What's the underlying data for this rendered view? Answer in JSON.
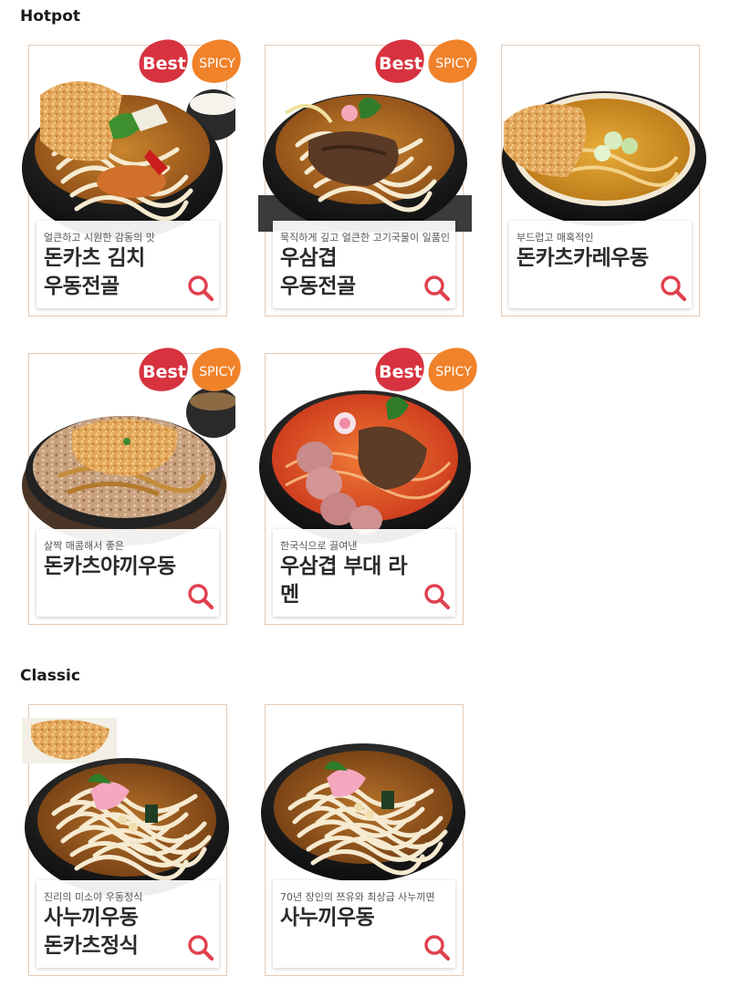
{
  "sections": {
    "hotpot": {
      "title": "Hotpot"
    },
    "classic": {
      "title": "Classic"
    }
  },
  "badges": {
    "best": "Best",
    "spicy": "SPICY"
  },
  "items": {
    "c1": {
      "tagline": "얼큰하고 시원한 감동의 맛",
      "name": "돈카츠 김치\n우동전골"
    },
    "c2": {
      "tagline": "묵직하게 깊고 얼큰한 고기국물이 일품인",
      "name": "우삼겹\n우동전골"
    },
    "c3": {
      "tagline": "부드럽고 매혹적인",
      "name": "돈카츠카레우동"
    },
    "c4": {
      "tagline": "살짝 매콤해서 좋은",
      "name": "돈카츠야끼우동"
    },
    "c5": {
      "tagline": "한국식으로 끓여낸",
      "name": "우삼겹 부대 라멘"
    },
    "c6": {
      "tagline": "진리의 미소야 우동정식",
      "name": "사누끼우동\n돈카츠정식"
    },
    "c7": {
      "tagline": "70년 장인의 쯔유와 최상급 사누끼면",
      "name": "사누끼우동"
    }
  },
  "colors": {
    "accent": "#e0404e",
    "best_badge": "#d7323f",
    "spicy_badge": "#f0822a",
    "card_border": "#e2c9b6"
  },
  "icons": {
    "zoom": "magnifier-icon"
  }
}
